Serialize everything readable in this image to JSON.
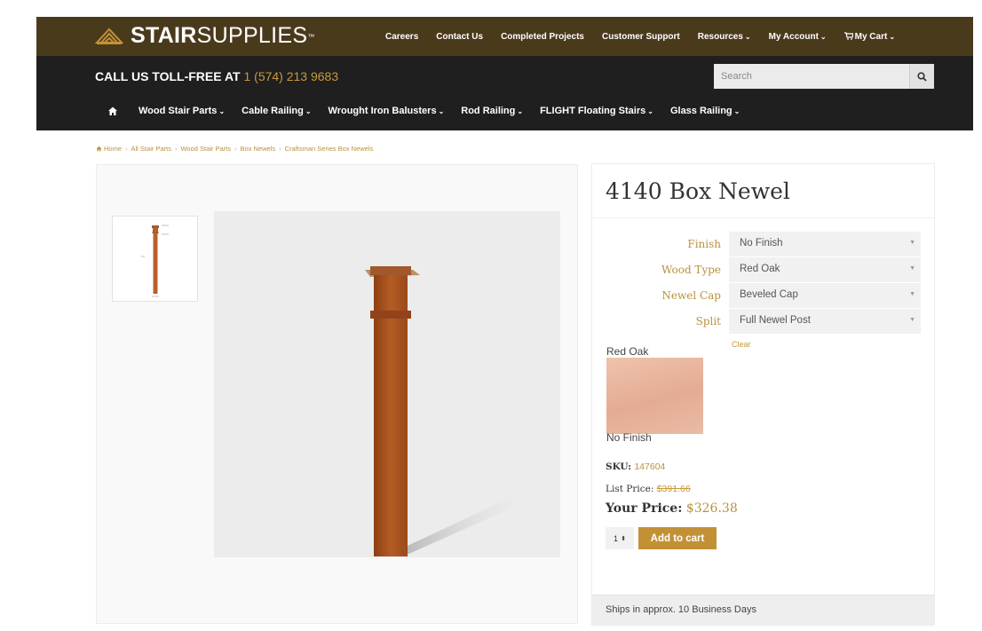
{
  "brand": {
    "bold": "STAIR",
    "regular": "SUPPLIES",
    "tm": "™",
    "color": "#4a3a1c",
    "accent": "#c29136"
  },
  "top_nav": {
    "careers": "Careers",
    "contact": "Contact Us",
    "projects": "Completed Projects",
    "support": "Customer Support",
    "resources": "Resources",
    "account": "My Account",
    "cart": "My Cart",
    "cart_icon": "cart-icon"
  },
  "header": {
    "tollfree_label": "CALL US TOLL-FREE AT",
    "phone": "1 (574) 213 9683"
  },
  "search": {
    "placeholder": "Search",
    "icon": "search-icon"
  },
  "main_nav": {
    "home_icon": "home-icon",
    "wood_stair_parts": "Wood Stair Parts",
    "cable_railing": "Cable Railing",
    "wrought_iron": "Wrought Iron Balusters",
    "rod_railing": "Rod Railing",
    "flight": "FLIGHT Floating Stairs",
    "glass_railing": "Glass Railing"
  },
  "breadcrumb": {
    "home": "Home",
    "all": "All Stair Parts",
    "wood": "Wood Stair Parts",
    "box": "Box Newels",
    "series": "Craftsman Series Box Newels"
  },
  "product": {
    "title": "4140 Box Newel",
    "options": [
      {
        "label": "Finish",
        "value": "No Finish"
      },
      {
        "label": "Wood Type",
        "value": "Red Oak"
      },
      {
        "label": "Newel Cap",
        "value": "Beveled Cap"
      },
      {
        "label": "Split",
        "value": "Full Newel Post"
      }
    ],
    "clear": "Clear",
    "swatch_top": "Red Oak",
    "swatch_bottom": "No Finish",
    "sku_label": "SKU:",
    "sku": "147604",
    "list_price_label": "List Price:",
    "list_price": "$391.66",
    "your_price_label": "Your Price:",
    "your_price": "$326.38",
    "qty": "1",
    "add_to_cart": "Add to cart",
    "ships": "Ships in approx. 10 Business Days"
  }
}
